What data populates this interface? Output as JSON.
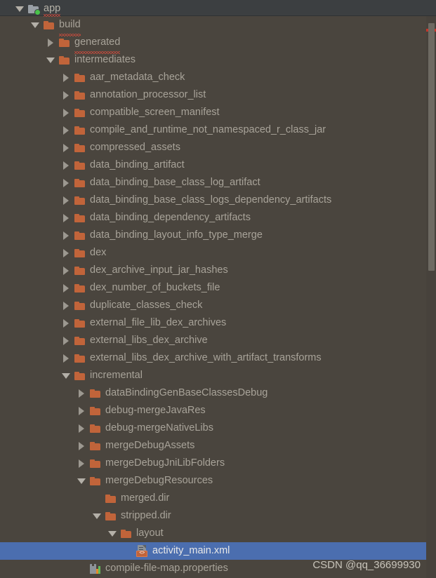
{
  "panel": {
    "name": "project-tree",
    "background_color": "#4a453e",
    "selection_color": "#4b6eaf",
    "folder_color": "#c1643a",
    "text_color": "#a8a399",
    "header_background": "#3c3f41"
  },
  "sticky_header": {
    "label": "app",
    "icon": "module-folder-icon",
    "twisty": "expanded",
    "squiggle": true
  },
  "watermark": {
    "text": "CSDN @qq_36699930"
  },
  "scrollbar": {
    "name": "vertical-scrollbar",
    "error_marker_color": "#c7362a"
  },
  "tree": {
    "rows": [
      {
        "label": "build",
        "depth": 1,
        "twisty": "expanded",
        "icon": "folder-icon",
        "squiggle": true,
        "selected": false
      },
      {
        "label": "generated",
        "depth": 2,
        "twisty": "collapsed",
        "icon": "folder-icon",
        "squiggle": true,
        "selected": false
      },
      {
        "label": "intermediates",
        "depth": 2,
        "twisty": "expanded",
        "icon": "folder-icon",
        "squiggle": false,
        "selected": false
      },
      {
        "label": "aar_metadata_check",
        "depth": 3,
        "twisty": "collapsed",
        "icon": "folder-icon",
        "squiggle": false,
        "selected": false
      },
      {
        "label": "annotation_processor_list",
        "depth": 3,
        "twisty": "collapsed",
        "icon": "folder-icon",
        "squiggle": false,
        "selected": false
      },
      {
        "label": "compatible_screen_manifest",
        "depth": 3,
        "twisty": "collapsed",
        "icon": "folder-icon",
        "squiggle": false,
        "selected": false
      },
      {
        "label": "compile_and_runtime_not_namespaced_r_class_jar",
        "depth": 3,
        "twisty": "collapsed",
        "icon": "folder-icon",
        "squiggle": false,
        "selected": false
      },
      {
        "label": "compressed_assets",
        "depth": 3,
        "twisty": "collapsed",
        "icon": "folder-icon",
        "squiggle": false,
        "selected": false
      },
      {
        "label": "data_binding_artifact",
        "depth": 3,
        "twisty": "collapsed",
        "icon": "folder-icon",
        "squiggle": false,
        "selected": false
      },
      {
        "label": "data_binding_base_class_log_artifact",
        "depth": 3,
        "twisty": "collapsed",
        "icon": "folder-icon",
        "squiggle": false,
        "selected": false
      },
      {
        "label": "data_binding_base_class_logs_dependency_artifacts",
        "depth": 3,
        "twisty": "collapsed",
        "icon": "folder-icon",
        "squiggle": false,
        "selected": false
      },
      {
        "label": "data_binding_dependency_artifacts",
        "depth": 3,
        "twisty": "collapsed",
        "icon": "folder-icon",
        "squiggle": false,
        "selected": false
      },
      {
        "label": "data_binding_layout_info_type_merge",
        "depth": 3,
        "twisty": "collapsed",
        "icon": "folder-icon",
        "squiggle": false,
        "selected": false
      },
      {
        "label": "dex",
        "depth": 3,
        "twisty": "collapsed",
        "icon": "folder-icon",
        "squiggle": false,
        "selected": false
      },
      {
        "label": "dex_archive_input_jar_hashes",
        "depth": 3,
        "twisty": "collapsed",
        "icon": "folder-icon",
        "squiggle": false,
        "selected": false
      },
      {
        "label": "dex_number_of_buckets_file",
        "depth": 3,
        "twisty": "collapsed",
        "icon": "folder-icon",
        "squiggle": false,
        "selected": false
      },
      {
        "label": "duplicate_classes_check",
        "depth": 3,
        "twisty": "collapsed",
        "icon": "folder-icon",
        "squiggle": false,
        "selected": false
      },
      {
        "label": "external_file_lib_dex_archives",
        "depth": 3,
        "twisty": "collapsed",
        "icon": "folder-icon",
        "squiggle": false,
        "selected": false
      },
      {
        "label": "external_libs_dex_archive",
        "depth": 3,
        "twisty": "collapsed",
        "icon": "folder-icon",
        "squiggle": false,
        "selected": false
      },
      {
        "label": "external_libs_dex_archive_with_artifact_transforms",
        "depth": 3,
        "twisty": "collapsed",
        "icon": "folder-icon",
        "squiggle": false,
        "selected": false
      },
      {
        "label": "incremental",
        "depth": 3,
        "twisty": "expanded",
        "icon": "folder-icon",
        "squiggle": false,
        "selected": false
      },
      {
        "label": "dataBindingGenBaseClassesDebug",
        "depth": 4,
        "twisty": "collapsed",
        "icon": "folder-icon",
        "squiggle": false,
        "selected": false
      },
      {
        "label": "debug-mergeJavaRes",
        "depth": 4,
        "twisty": "collapsed",
        "icon": "folder-icon",
        "squiggle": false,
        "selected": false
      },
      {
        "label": "debug-mergeNativeLibs",
        "depth": 4,
        "twisty": "collapsed",
        "icon": "folder-icon",
        "squiggle": false,
        "selected": false
      },
      {
        "label": "mergeDebugAssets",
        "depth": 4,
        "twisty": "collapsed",
        "icon": "folder-icon",
        "squiggle": false,
        "selected": false
      },
      {
        "label": "mergeDebugJniLibFolders",
        "depth": 4,
        "twisty": "collapsed",
        "icon": "folder-icon",
        "squiggle": false,
        "selected": false
      },
      {
        "label": "mergeDebugResources",
        "depth": 4,
        "twisty": "expanded",
        "icon": "folder-icon",
        "squiggle": false,
        "selected": false
      },
      {
        "label": "merged.dir",
        "depth": 5,
        "twisty": "none",
        "icon": "folder-icon",
        "squiggle": false,
        "selected": false
      },
      {
        "label": "stripped.dir",
        "depth": 5,
        "twisty": "expanded",
        "icon": "folder-icon",
        "squiggle": false,
        "selected": false
      },
      {
        "label": "layout",
        "depth": 6,
        "twisty": "expanded",
        "icon": "folder-icon",
        "squiggle": false,
        "selected": false
      },
      {
        "label": "activity_main.xml",
        "depth": 7,
        "twisty": "none",
        "icon": "xml-file-icon",
        "squiggle": false,
        "selected": true
      },
      {
        "label": "compile-file-map.properties",
        "depth": 4,
        "twisty": "none",
        "icon": "properties-file-icon",
        "squiggle": false,
        "selected": false
      }
    ]
  }
}
